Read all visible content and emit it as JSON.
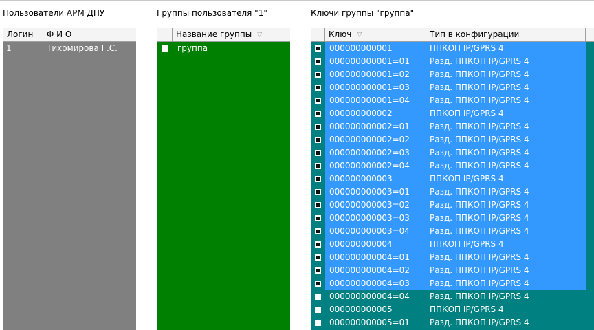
{
  "users_panel": {
    "title": "Пользователи АРМ ДПУ",
    "columns": {
      "login": "Логин",
      "fio": "Ф И О"
    },
    "rows": [
      {
        "login": "1",
        "fio": "Тихомирова Г.С."
      }
    ]
  },
  "groups_panel": {
    "title": "Группы пользователя \"1\"",
    "columns": {
      "name": "Название группы"
    },
    "rows": [
      {
        "checked": false,
        "name": "группа"
      }
    ]
  },
  "keys_panel": {
    "title": "Ключи группы \"группа\"",
    "columns": {
      "key": "Ключ",
      "type": "Тип в конфигурации"
    },
    "rows": [
      {
        "checked": true,
        "selected": true,
        "key": "000000000001",
        "type": "ППКОП IP/GPRS 4"
      },
      {
        "checked": true,
        "selected": true,
        "key": "000000000001=01",
        "type": "Разд. ППКОП IP/GPRS 4"
      },
      {
        "checked": true,
        "selected": true,
        "key": "000000000001=02",
        "type": "Разд. ППКОП IP/GPRS 4"
      },
      {
        "checked": true,
        "selected": true,
        "key": "000000000001=03",
        "type": "Разд. ППКОП IP/GPRS 4"
      },
      {
        "checked": true,
        "selected": true,
        "key": "000000000001=04",
        "type": "Разд. ППКОП IP/GPRS 4"
      },
      {
        "checked": true,
        "selected": true,
        "key": "000000000002",
        "type": "ППКОП IP/GPRS 4"
      },
      {
        "checked": true,
        "selected": true,
        "key": "000000000002=01",
        "type": "Разд. ППКОП IP/GPRS 4"
      },
      {
        "checked": true,
        "selected": true,
        "key": "000000000002=02",
        "type": "Разд. ППКОП IP/GPRS 4"
      },
      {
        "checked": true,
        "selected": true,
        "key": "000000000002=03",
        "type": "Разд. ППКОП IP/GPRS 4"
      },
      {
        "checked": true,
        "selected": true,
        "key": "000000000002=04",
        "type": "Разд. ППКОП IP/GPRS 4"
      },
      {
        "checked": true,
        "selected": true,
        "key": "000000000003",
        "type": "ППКОП IP/GPRS 4"
      },
      {
        "checked": true,
        "selected": true,
        "key": "000000000003=01",
        "type": "Разд. ППКОП IP/GPRS 4"
      },
      {
        "checked": true,
        "selected": true,
        "key": "000000000003=02",
        "type": "Разд. ППКОП IP/GPRS 4"
      },
      {
        "checked": true,
        "selected": true,
        "key": "000000000003=03",
        "type": "Разд. ППКОП IP/GPRS 4"
      },
      {
        "checked": true,
        "selected": true,
        "key": "000000000003=04",
        "type": "Разд. ППКОП IP/GPRS 4"
      },
      {
        "checked": true,
        "selected": true,
        "key": "000000000004",
        "type": "ППКОП IP/GPRS 4"
      },
      {
        "checked": true,
        "selected": true,
        "key": "000000000004=01",
        "type": "Разд. ППКОП IP/GPRS 4"
      },
      {
        "checked": true,
        "selected": true,
        "key": "000000000004=02",
        "type": "Разд. ППКОП IP/GPRS 4"
      },
      {
        "checked": true,
        "selected": true,
        "key": "000000000004=03",
        "type": "Разд. ППКОП IP/GPRS 4"
      },
      {
        "checked": false,
        "selected": false,
        "key": "000000000004=04",
        "type": "Разд. ППКОП IP/GPRS 4"
      },
      {
        "checked": false,
        "selected": false,
        "key": "000000000005",
        "type": "ППКОП IP/GPRS 4"
      },
      {
        "checked": false,
        "selected": false,
        "key": "000000000005=01",
        "type": "Разд. ППКОП IP/GPRS 4"
      }
    ]
  },
  "colors": {
    "users_bg": "#808080",
    "groups_bg": "#008000",
    "keys_bg": "#008080",
    "selection_bg": "#3399ff",
    "header_bg": "#f4f4f4"
  },
  "icons": {
    "sort": "sort-triangle-icon",
    "checkbox": "checkbox-icon"
  }
}
